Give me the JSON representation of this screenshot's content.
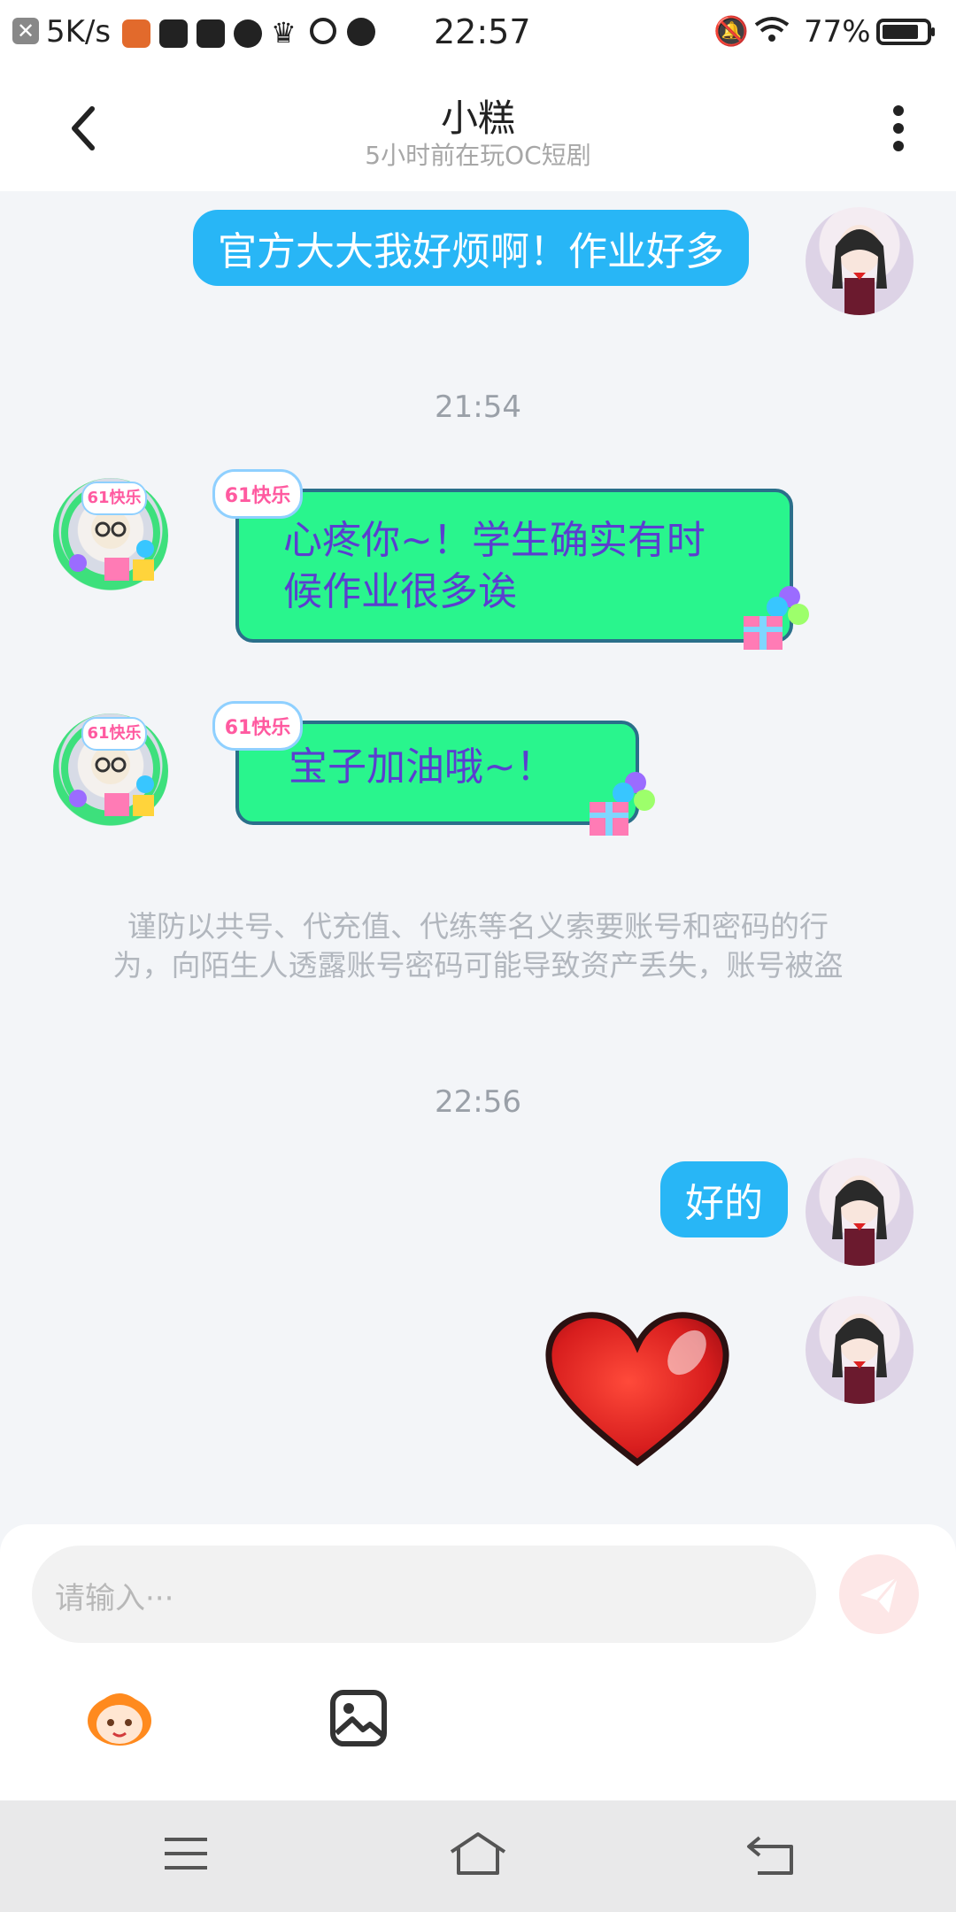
{
  "status_bar": {
    "net_speed": "5K/s",
    "time": "22:57",
    "battery": "77%",
    "icons": [
      "close-notification-icon",
      "game-icon",
      "message-icon",
      "app-icon",
      "pinwheel-icon",
      "crown-icon",
      "video-icon",
      "planet-icon",
      "bell-mute-icon",
      "wifi-icon",
      "battery-icon"
    ]
  },
  "header": {
    "title": "小糕",
    "subtitle": "5小时前在玩OC短剧"
  },
  "chat": {
    "messages": [
      {
        "side": "out",
        "text": "官方大大我好烦啊！作业好多"
      },
      {
        "side": "time",
        "text": "21:54"
      },
      {
        "side": "in",
        "badge": "61快乐",
        "lines": [
          "心疼你~！学生确实有时",
          "候作业很多诶"
        ]
      },
      {
        "side": "in",
        "badge": "61快乐",
        "lines": [
          "宝子加油哦~！"
        ]
      },
      {
        "side": "notice",
        "lines": [
          "谨防以共号、代充值、代练等名义索要账号和密码的行",
          "为，向陌生人透露账号密码可能导致资产丢失，账号被盗"
        ]
      },
      {
        "side": "time",
        "text": "22:56"
      },
      {
        "side": "out",
        "text": "好的"
      },
      {
        "side": "out-sticker",
        "icon": "heart-sticker-icon"
      }
    ]
  },
  "input": {
    "placeholder": "请输入···"
  },
  "colors": {
    "out_bubble": "#28b6f6",
    "in_bubble": "#29f58d",
    "in_text": "#5b3ecf",
    "send_disabled": "#fde7e7"
  }
}
